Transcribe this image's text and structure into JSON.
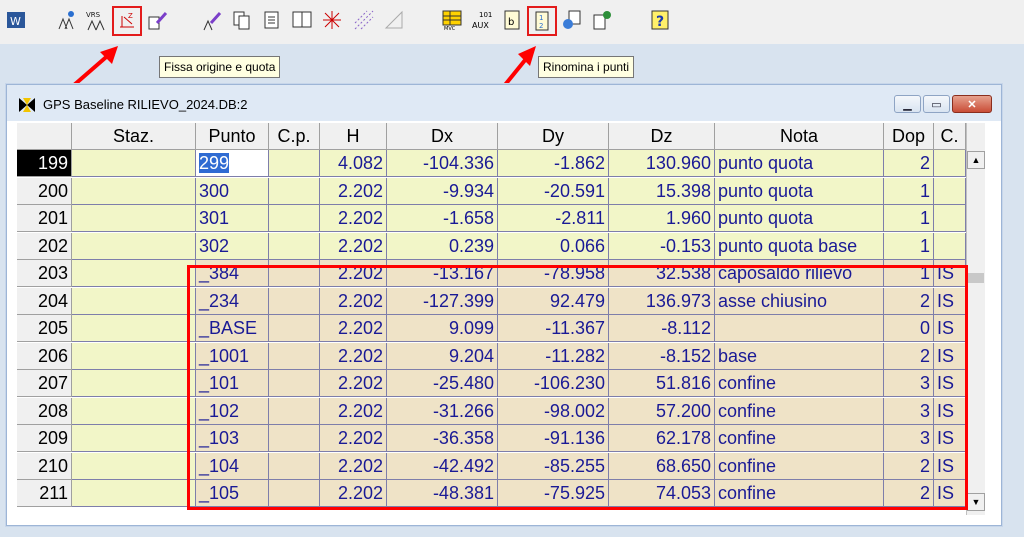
{
  "toolbar": {
    "tooltip_left": "Fissa origine e quota",
    "tooltip_right": "Rinomina i punti",
    "help_label": "?"
  },
  "window": {
    "title": "GPS Baseline RILIEVO_2024.DB:2"
  },
  "grid": {
    "headers": [
      "Staz.",
      "Punto",
      "C.p.",
      "H",
      "Dx",
      "Dy",
      "Dz",
      "Nota",
      "Dop",
      "C."
    ],
    "rows": [
      {
        "n": "199",
        "stz": "",
        "punto": "299",
        "cp": "",
        "h": "4.082",
        "dx": "-104.336",
        "dy": "-1.862",
        "dz": "130.960",
        "nota": "punto quota",
        "dop": "2",
        "c": ""
      },
      {
        "n": "200",
        "stz": "",
        "punto": "300",
        "cp": "",
        "h": "2.202",
        "dx": "-9.934",
        "dy": "-20.591",
        "dz": "15.398",
        "nota": "punto quota",
        "dop": "1",
        "c": ""
      },
      {
        "n": "201",
        "stz": "",
        "punto": "301",
        "cp": "",
        "h": "2.202",
        "dx": "-1.658",
        "dy": "-2.811",
        "dz": "1.960",
        "nota": "punto quota",
        "dop": "1",
        "c": ""
      },
      {
        "n": "202",
        "stz": "",
        "punto": "302",
        "cp": "",
        "h": "2.202",
        "dx": "0.239",
        "dy": "0.066",
        "dz": "-0.153",
        "nota": "punto quota base",
        "dop": "1",
        "c": ""
      },
      {
        "n": "203",
        "stz": "",
        "punto": "_384",
        "cp": "",
        "h": "2.202",
        "dx": "-13.167",
        "dy": "-78.958",
        "dz": "32.538",
        "nota": "caposaldo rilievo",
        "dop": "1",
        "c": "IS"
      },
      {
        "n": "204",
        "stz": "",
        "punto": "_234",
        "cp": "",
        "h": "2.202",
        "dx": "-127.399",
        "dy": "92.479",
        "dz": "136.973",
        "nota": "asse chiusino",
        "dop": "2",
        "c": "IS"
      },
      {
        "n": "205",
        "stz": "",
        "punto": "_BASE",
        "cp": "",
        "h": "2.202",
        "dx": "9.099",
        "dy": "-11.367",
        "dz": "-8.112",
        "nota": "",
        "dop": "0",
        "c": "IS"
      },
      {
        "n": "206",
        "stz": "",
        "punto": "_1001",
        "cp": "",
        "h": "2.202",
        "dx": "9.204",
        "dy": "-11.282",
        "dz": "-8.152",
        "nota": "base",
        "dop": "2",
        "c": "IS"
      },
      {
        "n": "207",
        "stz": "",
        "punto": "_101",
        "cp": "",
        "h": "2.202",
        "dx": "-25.480",
        "dy": "-106.230",
        "dz": "51.816",
        "nota": "confine",
        "dop": "3",
        "c": "IS"
      },
      {
        "n": "208",
        "stz": "",
        "punto": "_102",
        "cp": "",
        "h": "2.202",
        "dx": "-31.266",
        "dy": "-98.002",
        "dz": "57.200",
        "nota": "confine",
        "dop": "3",
        "c": "IS"
      },
      {
        "n": "209",
        "stz": "",
        "punto": "_103",
        "cp": "",
        "h": "2.202",
        "dx": "-36.358",
        "dy": "-91.136",
        "dz": "62.178",
        "nota": "confine",
        "dop": "3",
        "c": "IS"
      },
      {
        "n": "210",
        "stz": "",
        "punto": "_104",
        "cp": "",
        "h": "2.202",
        "dx": "-42.492",
        "dy": "-85.255",
        "dz": "68.650",
        "nota": "confine",
        "dop": "2",
        "c": "IS"
      },
      {
        "n": "211",
        "stz": "",
        "punto": "_105",
        "cp": "",
        "h": "2.202",
        "dx": "-48.381",
        "dy": "-75.925",
        "dz": "74.053",
        "nota": "confine",
        "dop": "2",
        "c": "IS"
      }
    ]
  },
  "colors": {
    "highlight_red": "#ff0000",
    "row_yellow": "#f2f6c8",
    "row_tan": "#efe3c7",
    "text_blue": "#1a1a96"
  }
}
